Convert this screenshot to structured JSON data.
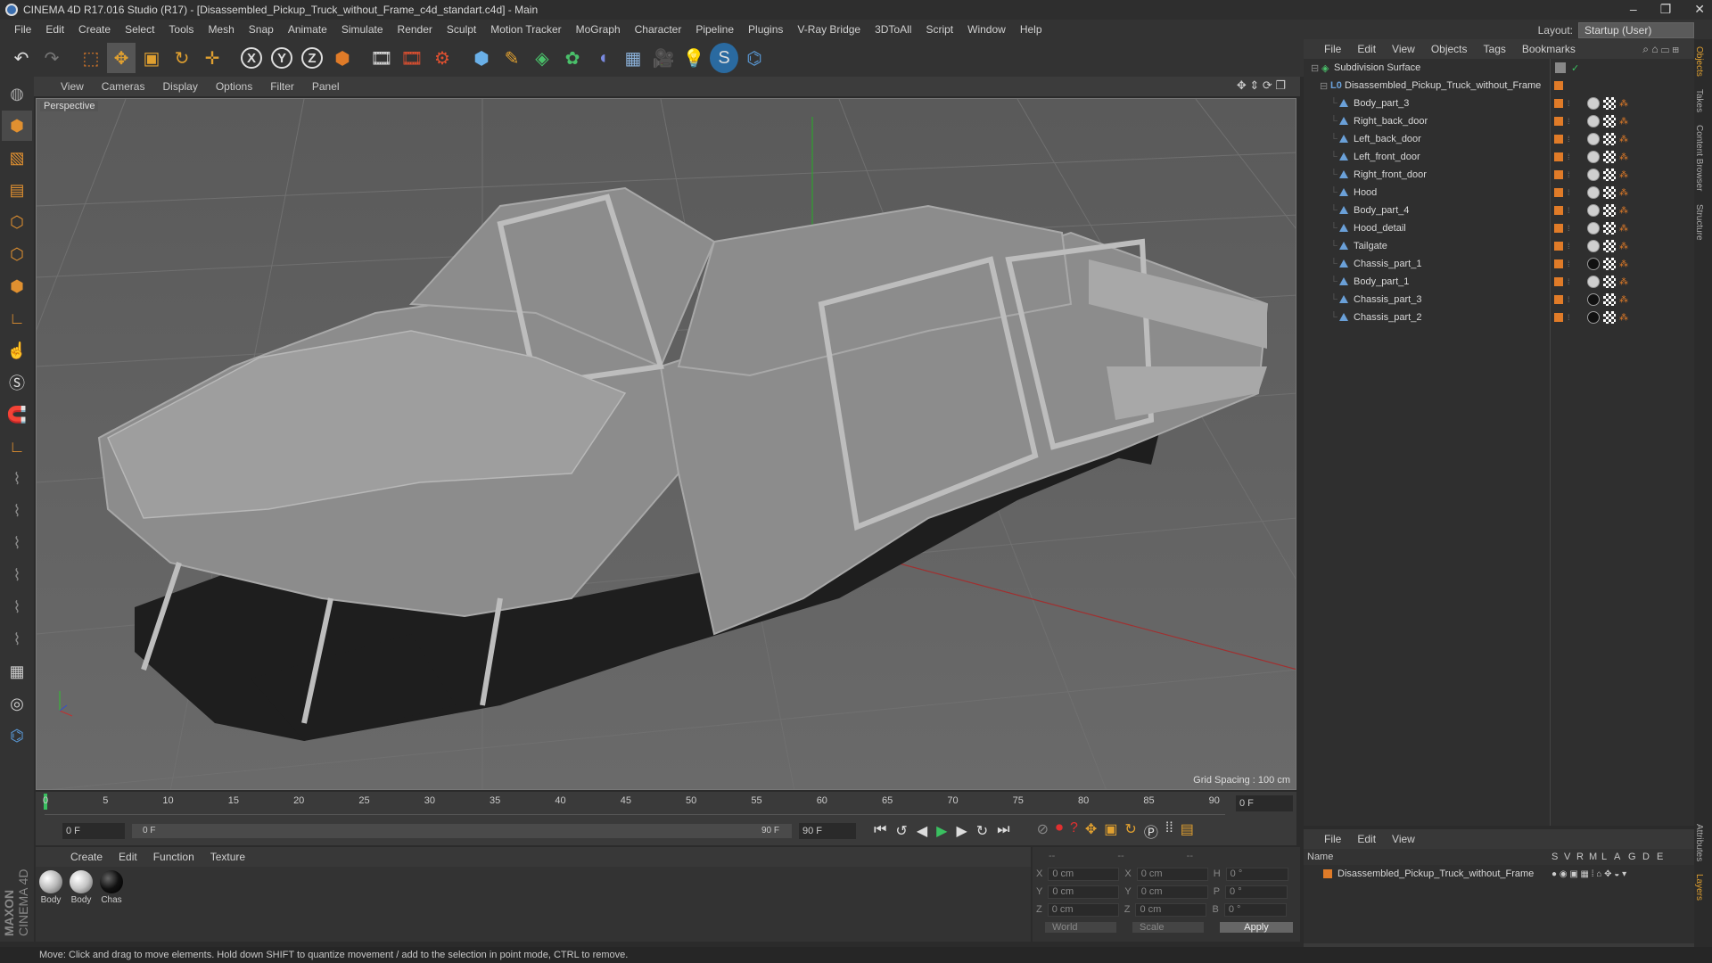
{
  "window": {
    "title": "CINEMA 4D R17.016 Studio (R17) - [Disassembled_Pickup_Truck_without_Frame_c4d_standart.c4d] - Main",
    "controls": [
      "–",
      "❐",
      "✕"
    ]
  },
  "menubar": {
    "items": [
      "File",
      "Edit",
      "Create",
      "Select",
      "Tools",
      "Mesh",
      "Snap",
      "Animate",
      "Simulate",
      "Render",
      "Sculpt",
      "Motion Tracker",
      "MoGraph",
      "Character",
      "Pipeline",
      "Plugins",
      "V-Ray Bridge",
      "3DToAll",
      "Script",
      "Window",
      "Help"
    ],
    "layout_label": "Layout:",
    "layout_value": "Startup (User)"
  },
  "toolbar": {
    "icons": [
      "undo-icon",
      "redo-icon",
      "live-selection-icon",
      "move-icon",
      "scale-icon",
      "rotate-icon",
      "transform-icon",
      "x-axis-icon",
      "y-axis-icon",
      "z-axis-icon",
      "world-coord-icon",
      "render-view-icon",
      "render-picture-icon",
      "render-settings-icon",
      "cube-icon",
      "pen-icon",
      "subdivision-icon",
      "array-icon",
      "deformer-icon",
      "floor-icon",
      "camera-icon",
      "light-icon",
      "script-icon",
      "python-icon"
    ],
    "axis_labels": [
      "X",
      "Y",
      "Z"
    ]
  },
  "viewport": {
    "menu": [
      "View",
      "Cameras",
      "Display",
      "Options",
      "Filter",
      "Panel"
    ],
    "label": "Perspective",
    "grid_spacing": "Grid Spacing : 100 cm"
  },
  "timeline": {
    "ticks": [
      "0",
      "5",
      "10",
      "15",
      "20",
      "25",
      "30",
      "35",
      "40",
      "45",
      "50",
      "55",
      "60",
      "65",
      "70",
      "75",
      "80",
      "85",
      "90"
    ],
    "current_frame": "0 F",
    "start_field": "0 F",
    "range_start": "0 F",
    "range_end": "90 F",
    "end_field": "90 F"
  },
  "material_panel": {
    "menu": [
      "Create",
      "Edit",
      "Function",
      "Texture"
    ],
    "materials": [
      {
        "name": "Body",
        "color": "#b8b8b8"
      },
      {
        "name": "Body",
        "color": "#c4c4c4"
      },
      {
        "name": "Chas",
        "color": "#111111"
      }
    ]
  },
  "coords": {
    "header": [
      "--",
      "--",
      "--"
    ],
    "rows": [
      {
        "a": "X",
        "av": "0 cm",
        "b": "X",
        "bv": "0 cm",
        "c": "H",
        "cv": "0 °"
      },
      {
        "a": "Y",
        "av": "0 cm",
        "b": "Y",
        "bv": "0 cm",
        "c": "P",
        "cv": "0 °"
      },
      {
        "a": "Z",
        "av": "0 cm",
        "b": "Z",
        "bv": "0 cm",
        "c": "B",
        "cv": "0 °"
      }
    ],
    "world": "World",
    "scale": "Scale",
    "apply": "Apply"
  },
  "object_manager": {
    "menu": [
      "File",
      "Edit",
      "View",
      "Objects",
      "Tags",
      "Bookmarks"
    ],
    "root": "Subdivision Surface",
    "group": "Disassembled_Pickup_Truck_without_Frame",
    "objects": [
      {
        "name": "Body_part_3",
        "tag": "#cfcfcf"
      },
      {
        "name": "Right_back_door",
        "tag": "#cfcfcf"
      },
      {
        "name": "Left_back_door",
        "tag": "#cfcfcf"
      },
      {
        "name": "Left_front_door",
        "tag": "#cfcfcf"
      },
      {
        "name": "Right_front_door",
        "tag": "#cfcfcf"
      },
      {
        "name": "Hood",
        "tag": "#cfcfcf"
      },
      {
        "name": "Body_part_4",
        "tag": "#cfcfcf"
      },
      {
        "name": "Hood_detail",
        "tag": "#cfcfcf"
      },
      {
        "name": "Tailgate",
        "tag": "#cfcfcf"
      },
      {
        "name": "Chassis_part_1",
        "tag": "#111111"
      },
      {
        "name": "Body_part_1",
        "tag": "#cfcfcf"
      },
      {
        "name": "Chassis_part_3",
        "tag": "#111111"
      },
      {
        "name": "Chassis_part_2",
        "tag": "#111111"
      }
    ]
  },
  "layer_manager": {
    "menu": [
      "File",
      "Edit",
      "View"
    ],
    "columns": [
      "Name",
      "S",
      "V",
      "R",
      "M",
      "L",
      "A",
      "G",
      "D",
      "E"
    ],
    "layer": "Disassembled_Pickup_Truck_without_Frame"
  },
  "side_tabs": [
    "Objects",
    "Takes",
    "Content Browser",
    "Structure",
    "Attributes",
    "Layers"
  ],
  "brand": [
    "MAXON",
    "CINEMA 4D"
  ],
  "status": "Move: Click and drag to move elements. Hold down SHIFT to quantize movement / add to the selection in point mode, CTRL to remove.",
  "colors": {
    "accent": "#e07b28",
    "selection": "#4a4a4a"
  }
}
